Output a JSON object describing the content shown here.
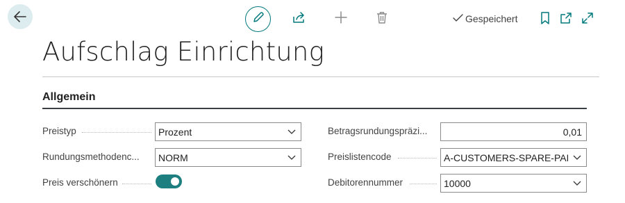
{
  "toolbar": {
    "saved_label": "Gespeichert"
  },
  "page": {
    "title": "Aufschlag Einrichtung"
  },
  "section": {
    "title": "Allgemein"
  },
  "fields_left": {
    "preistyp": {
      "label": "Preistyp",
      "value": "Prozent"
    },
    "rundungsmethode": {
      "label": "Rundungsmethodenc...",
      "value": "NORM"
    },
    "preis_verschoenern": {
      "label": "Preis verschönern",
      "value": true
    }
  },
  "fields_right": {
    "betragsrundung": {
      "label": "Betragsrundungspräzi...",
      "value": "0,01"
    },
    "preislistencode": {
      "label": "Preislistencode",
      "value": "A-CUSTOMERS-SPARE-PARTS"
    },
    "debitorennummer": {
      "label": "Debitorennummer",
      "value": "10000"
    }
  },
  "colors": {
    "accent": "#00787c",
    "toggle_on": "#1d7f7f",
    "back_button_bg": "#dcecef"
  }
}
